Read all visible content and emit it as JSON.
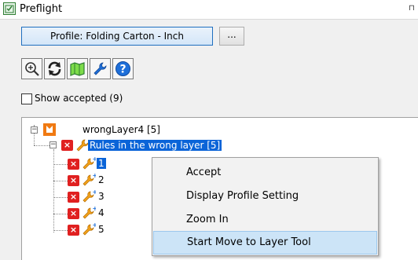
{
  "window": {
    "title": "Preflight",
    "pin_glyph": "⊓"
  },
  "profile": {
    "button_label": "Profile: Folding Carton - Inch",
    "more_label": "..."
  },
  "toolbar": {
    "buttons": [
      {
        "icon": "zoom-in-icon"
      },
      {
        "icon": "refresh-icon"
      },
      {
        "icon": "map-icon"
      },
      {
        "icon": "wrench-icon"
      },
      {
        "icon": "help-icon"
      }
    ]
  },
  "show_accepted": {
    "label": "Show accepted (9)",
    "checked": false
  },
  "tree": {
    "root": {
      "label": "wrongLayer4 [5]",
      "expander": "−"
    },
    "group": {
      "label": "Rules in the wrong layer [5]",
      "expander": "−"
    },
    "items": [
      "1",
      "2",
      "3",
      "4",
      "5"
    ],
    "error_glyph": "×"
  },
  "context_menu": {
    "items": [
      "Accept",
      "Display Profile Setting",
      "Zoom In",
      "Start Move to Layer Tool"
    ],
    "hovered_index": 3
  },
  "colors": {
    "selection": "#0a64d8",
    "error": "#e02020",
    "menu_hover": "#cce4f7"
  }
}
